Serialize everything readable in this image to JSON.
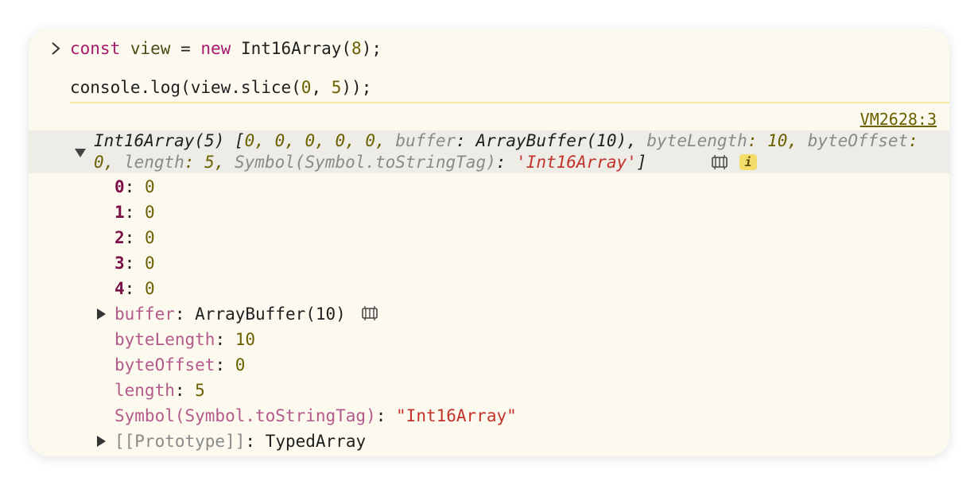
{
  "input": {
    "line1": {
      "kw_const": "const",
      "var": "view",
      "op": " = ",
      "kw_new": "new",
      "ctor": " Int16Array(",
      "arg": "8",
      "end": ");"
    },
    "line2": {
      "pre": "console.log(view.slice(",
      "a": "0",
      "comma": ", ",
      "b": "5",
      "end": "));"
    }
  },
  "source_link": "VM2628:3",
  "summary": {
    "head": "Int16Array(5) [",
    "vals": "0, 0, 0, 0, 0, ",
    "buffer_key": "buffer",
    "buffer_val": ": ArrayBuffer(10), ",
    "bytelen_key": "byteLength",
    "bytelen_val": ": 10, ",
    "byteoff_key": "byteOffset",
    "byteoff_val": ": 0, ",
    "length_key": "length",
    "length_val": ": 5, ",
    "tag_key": "Symbol(Symbol.toStringTag)",
    "tag_sep": ": ",
    "tag_val": "'Int16Array'",
    "close": "]",
    "info_badge": "i"
  },
  "entries": [
    {
      "key": "0",
      "value": "0"
    },
    {
      "key": "1",
      "value": "0"
    },
    {
      "key": "2",
      "value": "0"
    },
    {
      "key": "3",
      "value": "0"
    },
    {
      "key": "4",
      "value": "0"
    }
  ],
  "props": {
    "buffer": {
      "key": "buffer",
      "value": "ArrayBuffer(10)"
    },
    "byteLength": {
      "key": "byteLength",
      "value": "10"
    },
    "byteOffset": {
      "key": "byteOffset",
      "value": "0"
    },
    "length": {
      "key": "length",
      "value": "5"
    },
    "tag": {
      "key": "Symbol(Symbol.toStringTag)",
      "value": "\"Int16Array\""
    },
    "prototype": {
      "key": "[[Prototype]]",
      "value": "TypedArray"
    }
  },
  "colors": {
    "panel_bg": "#fcf9ef",
    "keyword": "#a7196b",
    "number": "#6b6000",
    "string": "#c2332b",
    "property": "#b35a8b",
    "index": "#7a1045",
    "divider": "#f2e7a5"
  },
  "icons": {
    "prompt": "chevron-right-icon",
    "expand": "triangle-down-icon",
    "collapse": "triangle-right-icon",
    "memory": "memory-chip-icon",
    "info": "info-icon"
  }
}
